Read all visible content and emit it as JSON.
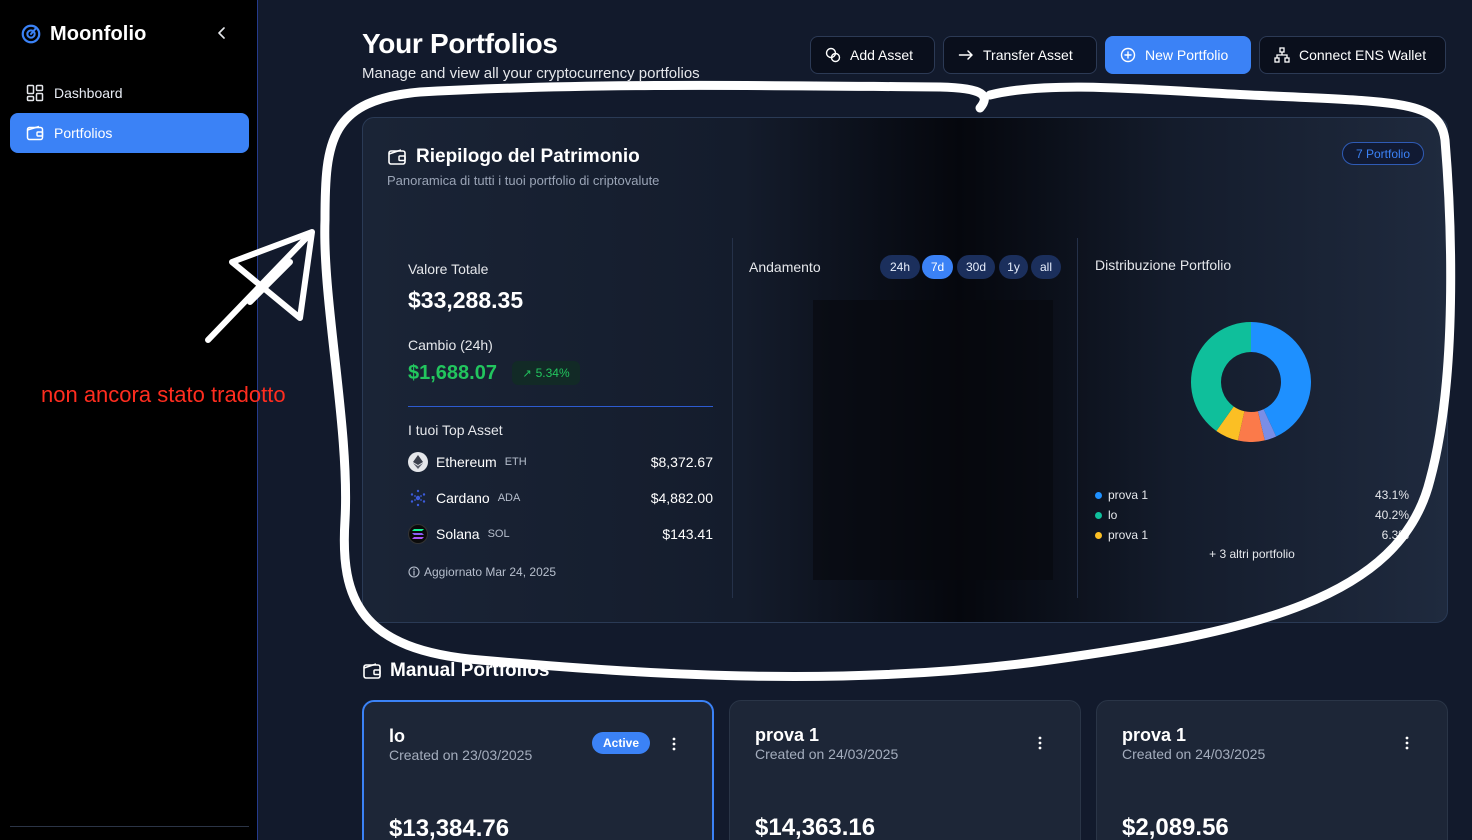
{
  "app": {
    "name": "Moonfolio"
  },
  "sidebar": {
    "items": [
      {
        "label": "Dashboard",
        "icon": "grid-icon",
        "active": false
      },
      {
        "label": "Portfolios",
        "icon": "wallet-icon",
        "active": true
      }
    ]
  },
  "annotation": {
    "note": "non ancora stato tradotto",
    "color": "#ff2d1f"
  },
  "header": {
    "title": "Your Portfolios",
    "subtitle": "Manage and view all your cryptocurrency portfolios",
    "buttons": {
      "add_asset": "Add Asset",
      "transfer_asset": "Transfer Asset",
      "new_portfolio": "New Portfolio",
      "connect_ens": "Connect ENS Wallet"
    }
  },
  "summary": {
    "title": "Riepilogo del Patrimonio",
    "subtitle": "Panoramica di tutti i tuoi portfolio di criptovalute",
    "badge": "7 Portfolio",
    "total_label": "Valore Totale",
    "total_value": "$33,288.35",
    "change_label": "Cambio (24h)",
    "change_value": "$1,688.07",
    "change_pct": "5.34%",
    "top_assets_label": "I tuoi Top Asset",
    "top_assets": [
      {
        "name": "Ethereum",
        "symbol": "ETH",
        "value": "$8,372.67",
        "icon": "ethereum-icon"
      },
      {
        "name": "Cardano",
        "symbol": "ADA",
        "value": "$4,882.00",
        "icon": "cardano-icon"
      },
      {
        "name": "Solana",
        "symbol": "SOL",
        "value": "$143.41",
        "icon": "solana-icon"
      }
    ],
    "updated": "Aggiornato Mar 24, 2025",
    "trend": {
      "label": "Andamento",
      "ranges": [
        "24h",
        "7d",
        "30d",
        "1y",
        "all"
      ],
      "selected": "7d"
    },
    "distribution": {
      "label": "Distribuzione Portfolio",
      "legend": [
        {
          "name": "prova 1",
          "pct": "43.1%",
          "color": "#1e90ff"
        },
        {
          "name": "lo",
          "pct": "40.2%",
          "color": "#0fbf9b"
        },
        {
          "name": "prova 1",
          "pct": "6.3%",
          "color": "#fbbf24"
        }
      ],
      "more": "+ 3 altri portfolio"
    }
  },
  "chart_data": {
    "type": "pie",
    "title": "Distribuzione Portfolio",
    "donut": true,
    "slices": [
      {
        "label": "prova 1",
        "value": 43.1,
        "color": "#1e90ff"
      },
      {
        "label": "",
        "value": 3.2,
        "color": "#7a8ee6"
      },
      {
        "label": "",
        "value": 7.2,
        "color": "#fb7a4a"
      },
      {
        "label": "prova 1",
        "value": 6.3,
        "color": "#fbbf24"
      },
      {
        "label": "lo",
        "value": 40.2,
        "color": "#0fbf9b"
      }
    ]
  },
  "manual": {
    "title": "Manual Portfolios",
    "cards": [
      {
        "name": "lo",
        "created": "Created on 23/03/2025",
        "value": "$13,384.76",
        "active": true,
        "badge": "Active"
      },
      {
        "name": "prova 1",
        "created": "Created on 24/03/2025",
        "value": "$14,363.16",
        "active": false
      },
      {
        "name": "prova 1",
        "created": "Created on 24/03/2025",
        "value": "$2,089.56",
        "active": false
      }
    ]
  }
}
